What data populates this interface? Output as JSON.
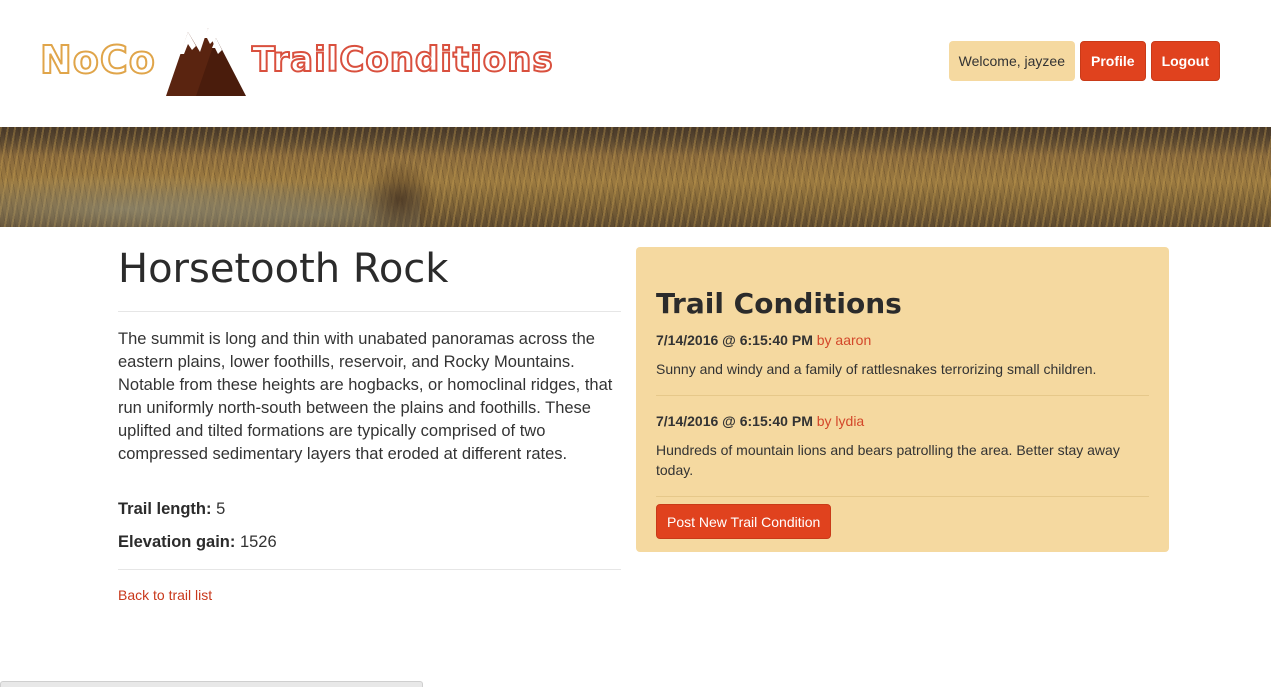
{
  "header": {
    "logo_left": "NoCo",
    "logo_right": "TrailConditions",
    "welcome": "Welcome, jayzee",
    "profile_label": "Profile",
    "logout_label": "Logout"
  },
  "trail": {
    "name": "Horsetooth Rock",
    "description": "The summit is long and thin with unabated panoramas across the eastern plains, lower foothills, reservoir, and Rocky Mountains. Notable from these heights are hogbacks, or homoclinal ridges, that run uniformly north-south between the plains and foothills. These uplifted and tilted formations are typically comprised of two compressed sedimentary layers that eroded at different rates.",
    "length_label": "Trail length:",
    "length_value": "5",
    "elevation_label": "Elevation gain:",
    "elevation_value": "1526",
    "back_link": "Back to trail list"
  },
  "conditions": {
    "title": "Trail Conditions",
    "items": [
      {
        "timestamp": "7/14/2016 @ 6:15:40 PM",
        "author": "by aaron",
        "text": "Sunny and windy and a family of rattlesnakes terrorizing small children."
      },
      {
        "timestamp": "7/14/2016 @ 6:15:40 PM",
        "author": "by lydia",
        "text": "Hundreds of mountain lions and bears patrolling the area. Better stay away today."
      }
    ],
    "post_button": "Post New Trail Condition"
  },
  "colors": {
    "accent": "#e0421e",
    "panel": "#f5d9a0",
    "logo_gold": "#e0a54a",
    "logo_red": "#d9503e",
    "mountain": "#5a2410"
  }
}
